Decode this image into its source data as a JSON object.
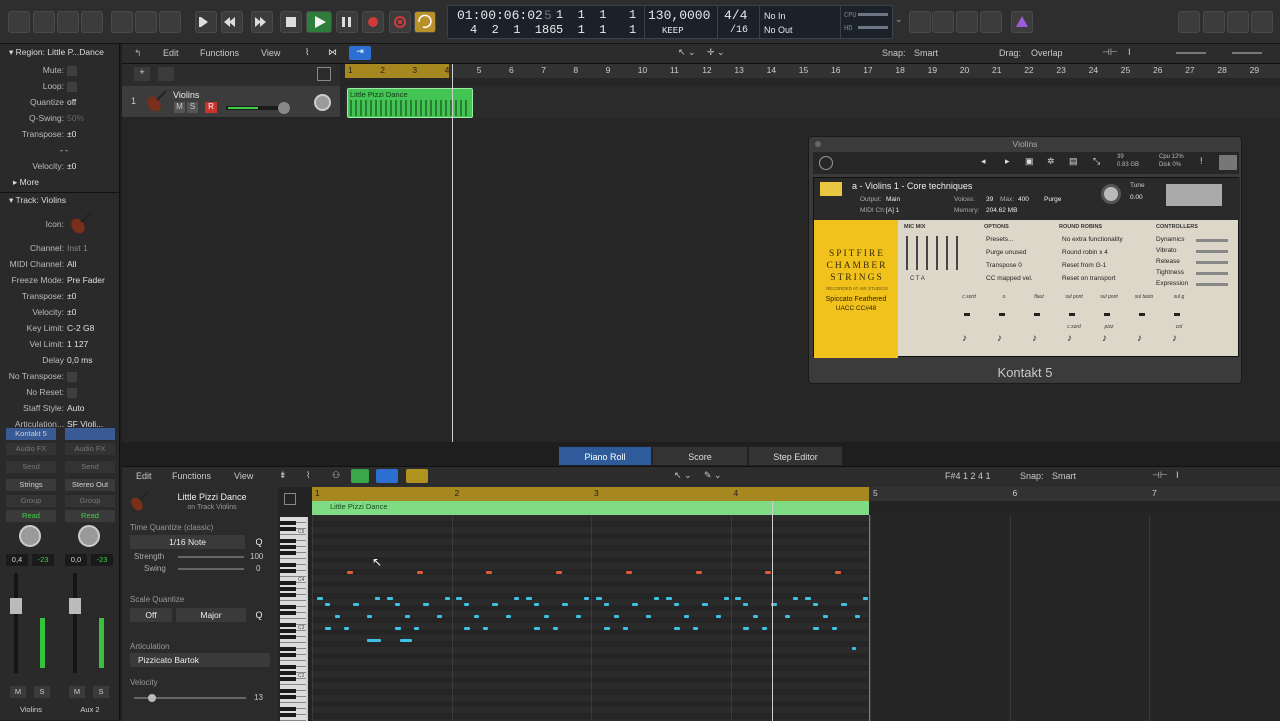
{
  "transport": {
    "position": "01:00:06:02",
    "bars_top": [
      "1",
      "1",
      "1",
      "1"
    ],
    "bars_bottom": [
      "4",
      "2",
      "1",
      "186"
    ],
    "bars_bottom2": [
      "5",
      "1",
      "1",
      "1"
    ],
    "tempo": "130,0000",
    "tempo_label": "KEEP",
    "signature_top": "4/4",
    "signature_bottom": "/16",
    "midi_in": "No In",
    "midi_out": "No Out",
    "cpu_label": "CPU",
    "hd_label": "HD"
  },
  "inspector": {
    "region_header": "Region: Little P...Dance",
    "region_rows": [
      {
        "k": "Mute:",
        "v": ""
      },
      {
        "k": "Loop:",
        "v": ""
      },
      {
        "k": "Quantize",
        "v": "off"
      },
      {
        "k": "Q-Swing:",
        "v": "50%"
      },
      {
        "k": "Transpose:",
        "v": "±0"
      },
      {
        "k": "",
        "v": "- -"
      },
      {
        "k": "Velocity:",
        "v": "±0"
      }
    ],
    "more": "More",
    "track_header": "Track:  Violins",
    "icon_label": "Icon:",
    "track_rows": [
      {
        "k": "Channel:",
        "v": "Inst 1"
      },
      {
        "k": "MIDI Channel:",
        "v": "All"
      },
      {
        "k": "Freeze Mode:",
        "v": "Pre Fader"
      },
      {
        "k": "Transpose:",
        "v": "±0"
      },
      {
        "k": "Velocity:",
        "v": "±0"
      },
      {
        "k": "Key Limit:",
        "v": "C-2  G8"
      },
      {
        "k": "Vel Limit:",
        "v": "1  127"
      },
      {
        "k": "Delay",
        "v": "0,0 ms"
      },
      {
        "k": "No Transpose:",
        "v": ""
      },
      {
        "k": "No Reset:",
        "v": ""
      },
      {
        "k": "Staff Style:",
        "v": "Auto"
      },
      {
        "k": "Articulation...",
        "v": "SF Violi..."
      }
    ],
    "strips": [
      {
        "slot": "Kontakt 5",
        "midi": "Strings",
        "fx": "Audio FX",
        "send": "Send",
        "out": "Strings",
        "group": "Group",
        "auto": "Read",
        "pan": "0,4",
        "peak": "-23",
        "m": "M",
        "s": "S",
        "name": "Violins"
      },
      {
        "slot": "",
        "midi": "",
        "fx": "Audio FX",
        "send": "Send",
        "out": "Stereo Out",
        "group": "Group",
        "auto": "Read",
        "pan": "0,0",
        "peak": "-23",
        "m": "M",
        "s": "S",
        "name": "Aux 2"
      }
    ]
  },
  "arrange": {
    "menus": [
      "Edit",
      "Functions",
      "View"
    ],
    "snap_label": "Snap:",
    "snap_value": "Smart",
    "drag_label": "Drag:",
    "drag_value": "Overlap",
    "ruler": [
      "1",
      "2",
      "3",
      "4",
      "5",
      "6",
      "7",
      "8",
      "9",
      "10",
      "11",
      "12",
      "13",
      "14",
      "15",
      "16",
      "17",
      "18",
      "19",
      "20",
      "21",
      "22",
      "23",
      "24",
      "25",
      "26",
      "27",
      "28",
      "29"
    ],
    "track": {
      "num": "1",
      "name": "Violins",
      "m": "M",
      "s": "S",
      "r": "R"
    },
    "region_name": "Little Pizzi Dance"
  },
  "kontakt": {
    "title": "Violins",
    "footer": "Kontakt 5",
    "instrument": "a - Violins 1 - Core techniques",
    "output_label": "Output:",
    "output": "Main",
    "voices_label": "Voices:",
    "voices": "39",
    "max_label": "Max:",
    "max": "400",
    "purge": "Purge",
    "midi_label": "MIDI Ch:",
    "midi": "[A]  1",
    "memory_label": "Memory:",
    "memory": "204.62 MB",
    "tune_label": "Tune",
    "tune": "0.00",
    "cpu_stats": "Cpu 12%",
    "disk_stats": "Disk 0%",
    "voices_stats": "39",
    "mem_stats": "0.83 GB",
    "brand": [
      "SPITFIRE",
      "CHAMBER",
      "STRINGS"
    ],
    "subbrand": "RECORDED AT AIR STUDIOS",
    "patch": "Spiccato Feathered",
    "patch2": "UACC CC#48",
    "mic_mix": "MIC MIX",
    "mics": "C   T   A",
    "options_label": "OPTIONS",
    "options": [
      "Presets...",
      "Purge unused",
      "Transpose   0",
      "CC mapped vel."
    ],
    "rr_label": "ROUND ROBINS",
    "rr": [
      "No extra functionality",
      "Round robin   x 4",
      "Reset from   G-1",
      "Reset on transport"
    ],
    "ctrl_label": "CONTROLLERS",
    "ctrls": [
      "Dynamics",
      "Vibrato",
      "Release",
      "Tightness",
      "Expression"
    ],
    "artic": [
      "c.sord",
      "o",
      "flaut",
      "sul pont",
      "sul pont",
      "sul tasto",
      "sul g"
    ],
    "artic2": [
      "",
      "",
      "",
      "c.sord",
      "pizz",
      "",
      "col"
    ]
  },
  "piano": {
    "tabs": [
      "Piano Roll",
      "Score",
      "Step Editor"
    ],
    "menus": [
      "Edit",
      "Functions",
      "View"
    ],
    "position": "F#4  1 2 4 1",
    "snap_label": "Snap:",
    "snap_value": "Smart",
    "region_title": "Little Pizzi Dance",
    "region_sub": "on Track Violins",
    "tq_label": "Time Quantize (classic)",
    "tq_value": "1/16 Note",
    "q": "Q",
    "strength_label": "Strength",
    "strength_value": "100",
    "swing_label": "Swing",
    "swing_value": "0",
    "sq_label": "Scale Quantize",
    "sq_off": "Off",
    "sq_scale": "Major",
    "art_label": "Articulation",
    "art_value": "Pizzicato Bartok",
    "vel_label": "Velocity",
    "vel_value": "13",
    "ruler": [
      "1",
      "2",
      "3",
      "4",
      "5",
      "6",
      "7"
    ],
    "region_name": "Little Pizzi Dance",
    "octaves": [
      "C5",
      "C4",
      "C3",
      "C2"
    ]
  }
}
